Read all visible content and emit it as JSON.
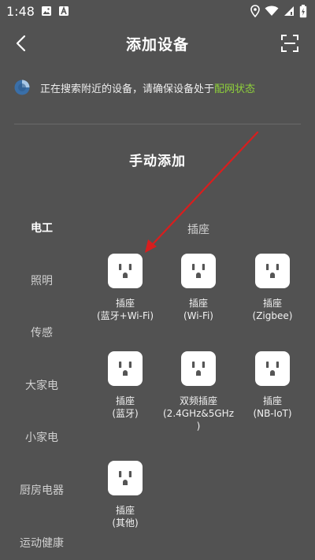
{
  "status_bar": {
    "time": "1:48",
    "icons": [
      "image-icon",
      "a-app-icon",
      "location-icon",
      "wifi-icon",
      "signal-icon",
      "battery-charging-icon"
    ]
  },
  "header": {
    "title": "添加设备",
    "back_icon": "chevron-left-icon",
    "scan_icon": "scan-icon"
  },
  "search": {
    "message": "正在搜索附近的设备，请确保设备处于",
    "link": "配网状态",
    "link_color": "#8fd13a"
  },
  "section_title": "手动添加",
  "sidebar": {
    "items": [
      {
        "label": "电工",
        "active": true
      },
      {
        "label": "照明",
        "active": false
      },
      {
        "label": "传感",
        "active": false
      },
      {
        "label": "大家电",
        "active": false
      },
      {
        "label": "小家电",
        "active": false
      },
      {
        "label": "厨房电器",
        "active": false
      },
      {
        "label": "运动健康",
        "active": false
      }
    ]
  },
  "group": {
    "title": "插座",
    "devices": [
      {
        "line1": "插座",
        "line2": "(蓝牙+Wi-Fi)",
        "line3": ""
      },
      {
        "line1": "插座",
        "line2": "(Wi-Fi)",
        "line3": ""
      },
      {
        "line1": "插座",
        "line2": "(Zigbee)",
        "line3": ""
      },
      {
        "line1": "插座",
        "line2": "(蓝牙)",
        "line3": ""
      },
      {
        "line1": "双频插座",
        "line2": "(2.4GHz&5GHz",
        "line3": ")"
      },
      {
        "line1": "插座",
        "line2": "(NB-IoT)",
        "line3": ""
      },
      {
        "line1": "插座",
        "line2": "(其他)",
        "line3": ""
      }
    ]
  },
  "colors": {
    "background": "#525252",
    "annotation_arrow": "#d81e1e",
    "accent_link": "#8fd13a"
  }
}
